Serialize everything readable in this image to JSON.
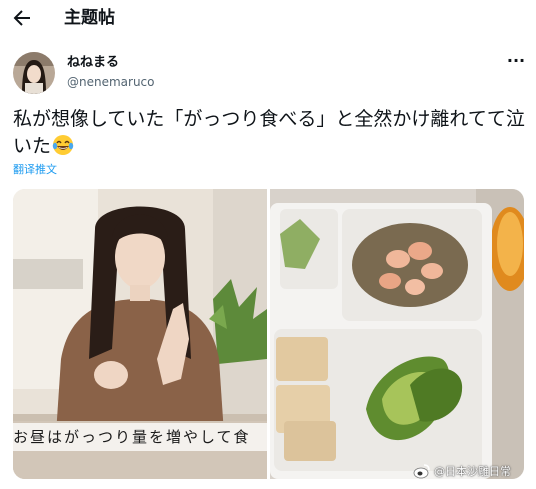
{
  "header": {
    "back_icon": "arrow-left-icon",
    "title": "主题帖"
  },
  "post": {
    "author": {
      "display_name": "ねねまる",
      "handle": "@nenemaruco"
    },
    "more_icon": "more-horizontal-icon",
    "more_label": "···",
    "text": "私が想像していた「がっつり食べる」と全然かけ離れてて泣いた",
    "emoji": "face-with-tears-of-joy",
    "translate_label": "翻译推文",
    "photos": [
      {
        "caption": "お昼はがっつり量を増やして食"
      },
      {
        "caption": ""
      }
    ]
  },
  "watermark": {
    "text": "@日本沙雕日常",
    "icon": "weibo-icon"
  },
  "colors": {
    "link": "#1d9bf0",
    "secondary_text": "#536471",
    "primary_text": "#0f1419"
  }
}
